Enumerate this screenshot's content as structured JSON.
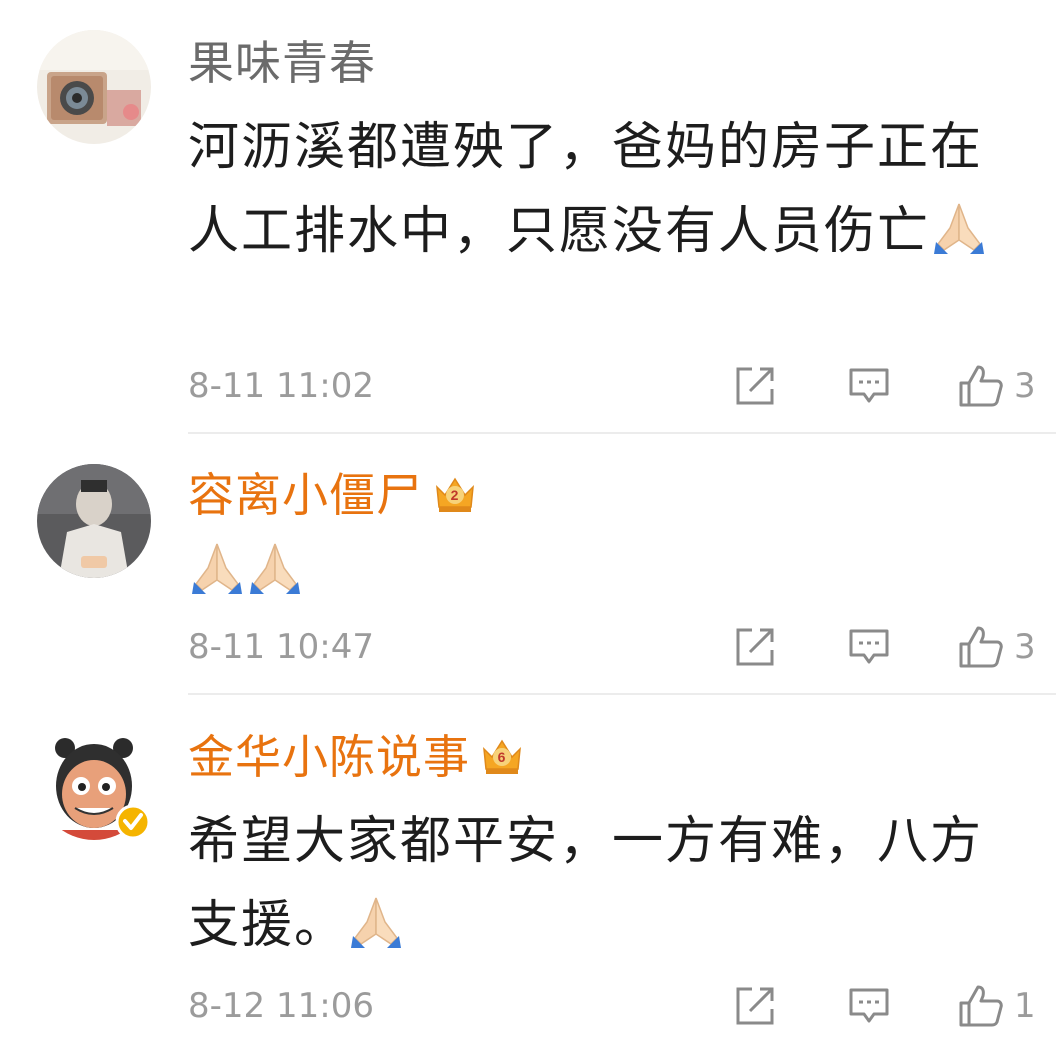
{
  "comments": [
    {
      "username": "果味青春",
      "text": "河沥溪都遭殃了，爸妈的房子正在人工排水中，只愿没有人员伤亡",
      "emoji": "folded-hands-icon",
      "time": "8-11 11:02",
      "likes": "3",
      "vip": false
    },
    {
      "username": "容离小僵尸",
      "text": "",
      "emoji": "folded-hands-icon x2",
      "time": "8-11 10:47",
      "likes": "3",
      "vip": true,
      "vip_level": "2"
    },
    {
      "username": "金华小陈说事",
      "text": "希望大家都平安，一方有难，八方支援。",
      "emoji": "folded-hands-icon",
      "time": "8-12 11:06",
      "likes": "1",
      "vip": true,
      "vip_level": "6",
      "verified": true
    }
  ],
  "colors": {
    "vip_name": "#e8730f",
    "plain_name": "#6b6b6b",
    "meta": "#9b9b9b",
    "verified_badge": "#f5b400"
  },
  "icons": {
    "share": "share-icon",
    "comment": "comment-icon",
    "like": "thumbs-up-icon"
  }
}
